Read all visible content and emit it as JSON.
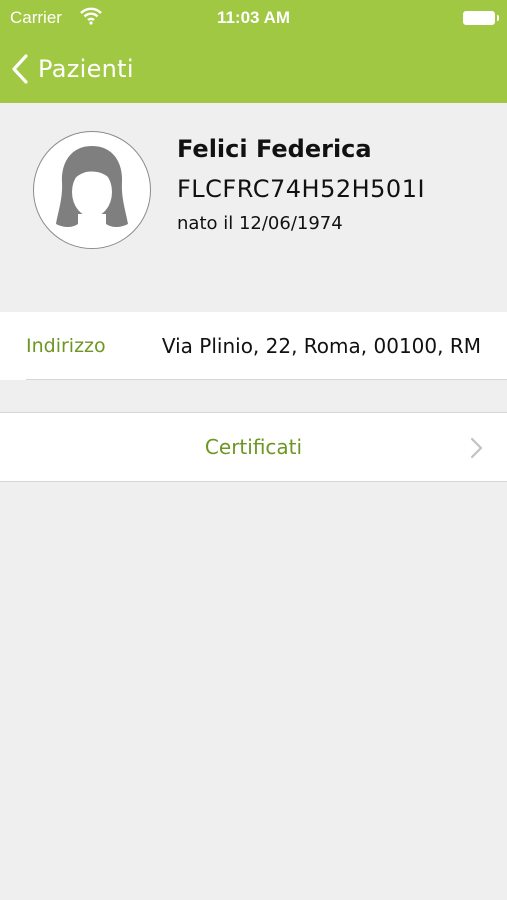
{
  "status_bar": {
    "carrier": "Carrier",
    "time": "11:03 AM",
    "wifi_icon": "wifi-icon",
    "battery_icon": "battery-icon"
  },
  "nav": {
    "back_label": "Pazienti",
    "back_icon": "chevron-left-icon",
    "accent_color": "#a0c842"
  },
  "patient": {
    "name": "Felici Federica",
    "tax_code": "FLCFRC74H52H501I",
    "birth": "nato il 12/06/1974",
    "avatar_icon": "female-avatar-icon"
  },
  "address": {
    "label": "Indirizzo",
    "value": "Via Plinio, 22, Roma, 00100, RM"
  },
  "certificates": {
    "label": "Certificati",
    "chevron_icon": "chevron-right-icon"
  }
}
